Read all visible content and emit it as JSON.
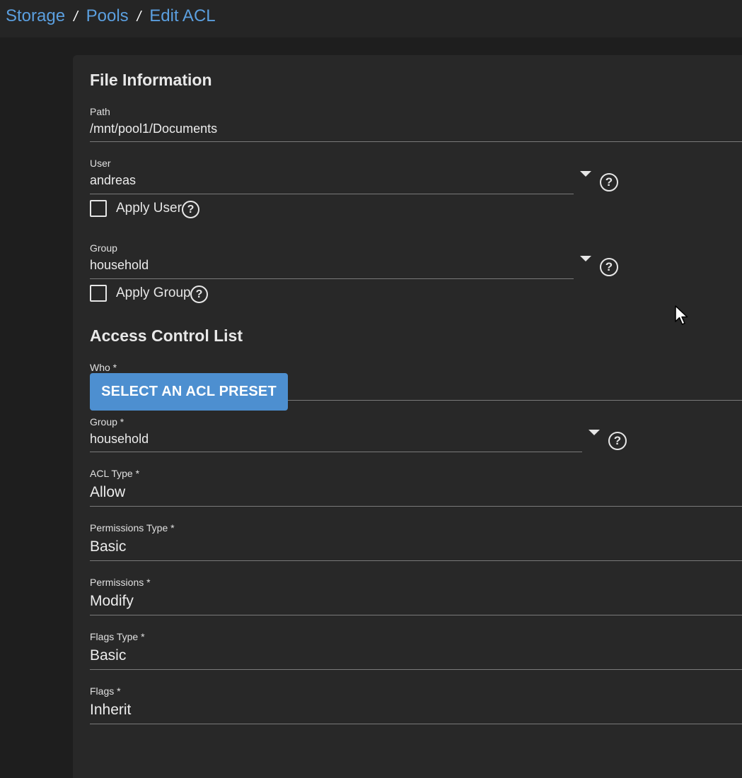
{
  "breadcrumb": {
    "items": [
      "Storage",
      "Pools",
      "Edit ACL"
    ],
    "separator": "/"
  },
  "file_info": {
    "title": "File Information",
    "path": {
      "label": "Path",
      "value": "/mnt/pool1/Documents"
    },
    "user": {
      "label": "User",
      "value": "andreas"
    },
    "apply_user": {
      "label": "Apply User",
      "checked": false
    },
    "group": {
      "label": "Group",
      "value": "household"
    },
    "apply_group": {
      "label": "Apply Group",
      "checked": false
    }
  },
  "acl": {
    "title": "Access Control List",
    "who": {
      "label": "Who *"
    },
    "preset_button": "SELECT AN ACL PRESET",
    "group": {
      "label": "Group *",
      "value": "household"
    },
    "acl_type": {
      "label": "ACL Type *",
      "value": "Allow"
    },
    "permissions_type": {
      "label": "Permissions Type *",
      "value": "Basic"
    },
    "permissions": {
      "label": "Permissions *",
      "value": "Modify"
    },
    "flags_type": {
      "label": "Flags Type *",
      "value": "Basic"
    },
    "flags": {
      "label": "Flags *",
      "value": "Inherit"
    }
  },
  "icons": {
    "help": "help-circle-icon",
    "dropdown": "caret-down-icon",
    "pointer": "mouse-cursor-icon"
  },
  "colors": {
    "accent": "#5b9fdf",
    "button": "#4d8fd0",
    "background": "#1e1e1e",
    "card": "#282828"
  }
}
